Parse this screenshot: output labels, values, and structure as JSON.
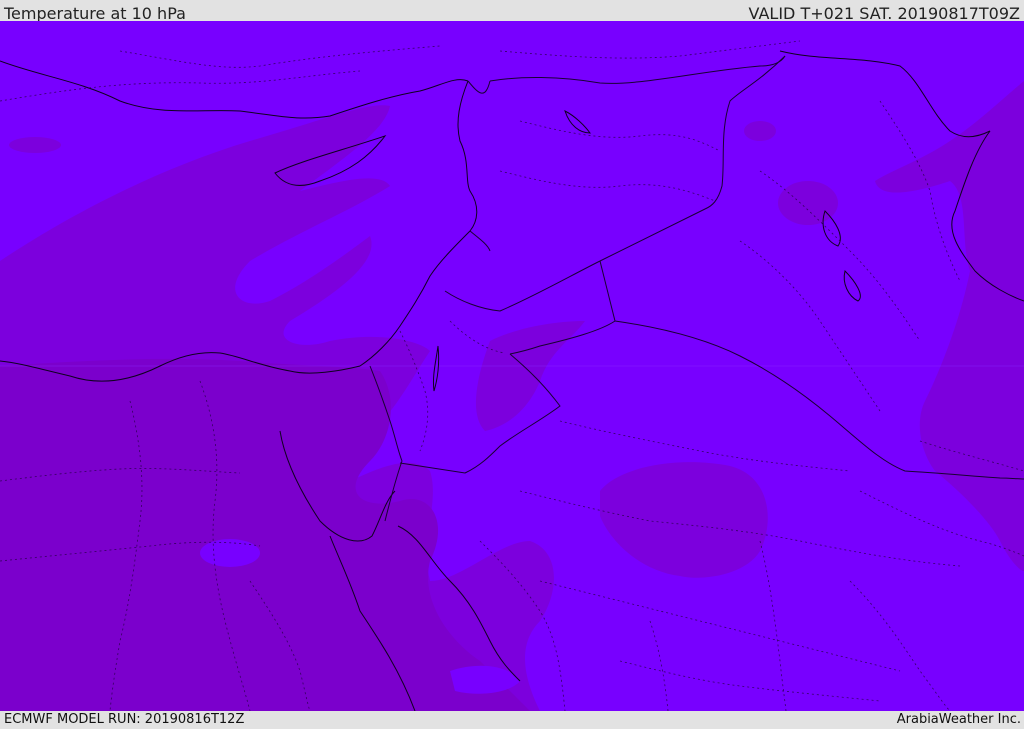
{
  "header": {
    "title": "Temperature at 10 hPa",
    "valid": "VALID T+021 SAT. 20190817T09Z"
  },
  "footer": {
    "model_run": "ECMWF MODEL RUN: 20190816T12Z",
    "credit": "ArabiaWeather Inc."
  },
  "colors": {
    "field_base": "#7800ff",
    "field_darker": "#7c00dd",
    "field_darkest": "#7b00cc",
    "border_line": "#1a0033",
    "coast_line": "#100020"
  }
}
